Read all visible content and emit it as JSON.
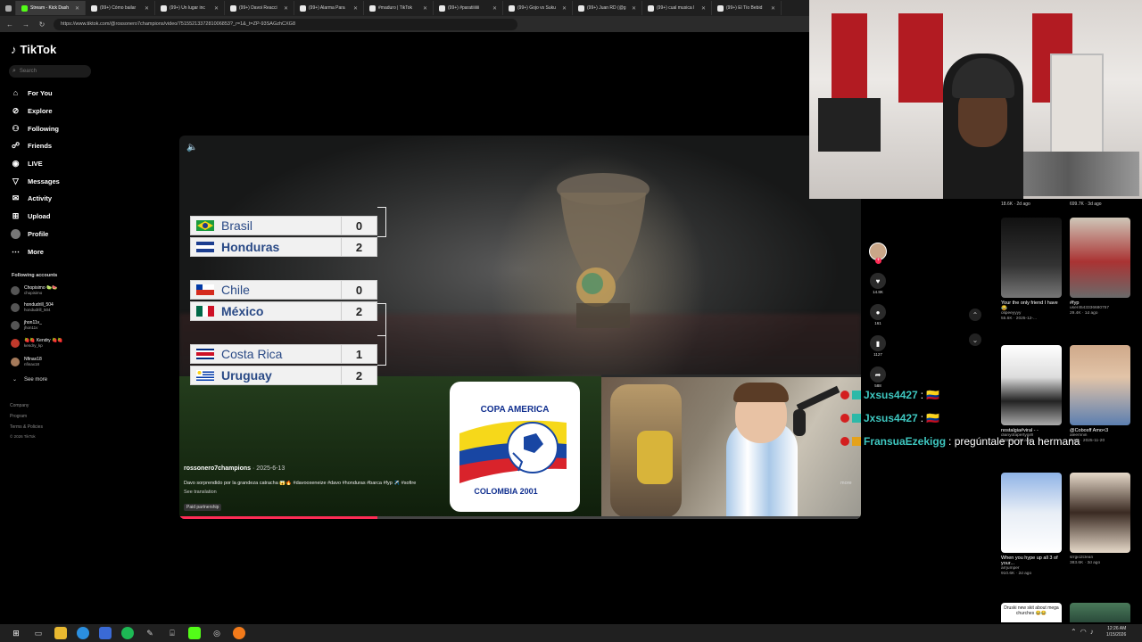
{
  "browser": {
    "tabs": [
      {
        "label": "Stream - Kick Dash"
      },
      {
        "label": "(99+) Cómo bailar"
      },
      {
        "label": "(99+) Un lugar inc"
      },
      {
        "label": "(99+) Davoi Reacci"
      },
      {
        "label": "(99+) Alarma Para"
      },
      {
        "label": "#maduro | TikTok"
      },
      {
        "label": "(99+) #paratiiiiiii"
      },
      {
        "label": "(99+) Gojo vs Suku"
      },
      {
        "label": "(99+) Juan RD (@g"
      },
      {
        "label": "(99+) cual musica l"
      },
      {
        "label": "(99+) El Tío Bebid"
      }
    ],
    "url": "https://www.tiktok.com/@rossonero7champions/video/7515521337281006853?_r=1&_t=ZP-93SAGzhCXG8"
  },
  "sidebar": {
    "logo": "TikTok",
    "search_placeholder": "Search",
    "nav": [
      {
        "label": "For You",
        "icon": "home-icon"
      },
      {
        "label": "Explore",
        "icon": "compass-icon"
      },
      {
        "label": "Following",
        "icon": "following-icon"
      },
      {
        "label": "Friends",
        "icon": "friends-icon"
      },
      {
        "label": "LIVE",
        "icon": "live-icon"
      },
      {
        "label": "Messages",
        "icon": "messages-icon"
      },
      {
        "label": "Activity",
        "icon": "activity-icon"
      },
      {
        "label": "Upload",
        "icon": "upload-icon"
      },
      {
        "label": "Profile",
        "icon": "profile-icon"
      },
      {
        "label": "More",
        "icon": "more-icon"
      }
    ],
    "following_title": "Following accounts",
    "following": [
      {
        "name": "Chopisimo 🍋‍🟩🍉",
        "handle": "chopisimo"
      },
      {
        "name": "hondudrill_504",
        "handle": "hondudrill_504"
      },
      {
        "name": "jhon11v_",
        "handle": "jhon11v"
      },
      {
        "name": "🍓🍓 Kendry 🍓🍓",
        "handle": "kendry_kp"
      },
      {
        "name": "Nfinax18",
        "handle": "nfinax18"
      }
    ],
    "see_more": "See more",
    "footer": [
      "Company",
      "Program",
      "Terms & Policies",
      "© 2026 TikTok"
    ]
  },
  "video": {
    "matches": [
      {
        "teams": [
          {
            "name": "Brasil",
            "score": "0"
          },
          {
            "name": "Honduras",
            "score": "2"
          }
        ]
      },
      {
        "teams": [
          {
            "name": "Chile",
            "score": "0"
          },
          {
            "name": "México",
            "score": "2"
          }
        ]
      },
      {
        "teams": [
          {
            "name": "Costa Rica",
            "score": "1"
          },
          {
            "name": "Uruguay",
            "score": "2"
          }
        ]
      }
    ],
    "logo_title": "COPA AMERICA",
    "logo_sub": "COLOMBIA 2001",
    "author": "rossonero7champions",
    "date": "· 2025-6-13",
    "caption": "Davo sorprendido por la grandeza catracha 😱🔥 #davooxeneize #davo #honduras #barca #fyp ✈️ #sofire",
    "see_translation": "See translation",
    "paid": "Paid partnership",
    "more": "more",
    "progress_fraction": 0.29
  },
  "actions": [
    {
      "icon": "heart-icon",
      "count": "14.8K"
    },
    {
      "icon": "comment-icon",
      "count": "161"
    },
    {
      "icon": "bookmark-icon",
      "count": "1127"
    },
    {
      "icon": "share-icon",
      "count": "588"
    }
  ],
  "chat": [
    {
      "user": "Jxsus4427",
      "msg": ": 🇨🇴"
    },
    {
      "user": "Jxsus4427",
      "msg": ": 🇨🇴"
    },
    {
      "user": "FransuaEzekigg",
      "msg": ": pregúntale por la hermana"
    }
  ],
  "feed": [
    {
      "title": "",
      "user": "",
      "meta": "18.6K · 2d ago"
    },
    {
      "title": "",
      "user": "",
      "meta": "699.7K · 3d ago"
    },
    {
      "title": "Your the only friend I have 😂",
      "user": "olipeeyyyy",
      "meta": "55.6K · 2025-12-..."
    },
    {
      "title": "#fyp",
      "user": "user4543336680757",
      "meta": "29.4K · 1d ago"
    },
    {
      "title": "nostalgia#viral - -",
      "user": "dianyofapertygirll",
      "meta": "249.8K · 3d ago"
    },
    {
      "title": "@Cobosff Amo<3",
      "user": "aleemnin",
      "meta": "2.1M · 2025-11-20"
    },
    {
      "title": "When you hype up all 3 of your...",
      "user": "arrjumper",
      "meta": "910.6K · 2d ago"
    },
    {
      "title": "",
      "user": "srrgio2clean",
      "meta": "383.6K · 3d ago"
    },
    {
      "title": "Druski new skit about mega churches 😂😂",
      "user": "",
      "meta": ""
    }
  ],
  "taskbar": {
    "clock_time": "12:26 AM",
    "clock_date": "1/15/2026"
  },
  "colors": {
    "accent": "#fe2c55",
    "chat_user": "#3ec7c0",
    "team_text": "#2a4a86"
  }
}
